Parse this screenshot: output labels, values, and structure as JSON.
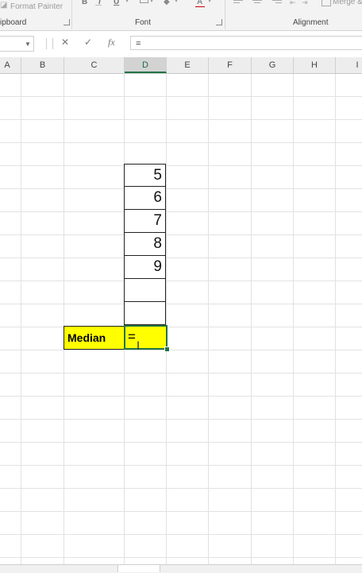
{
  "ribbon": {
    "format_painter_label": "Format Painter",
    "clipboard_group": "ipboard",
    "font_group": "Font",
    "alignment_group": "Alignment",
    "merge_label": "Merge &",
    "bold_label": "B",
    "italic_label": "I",
    "underline_label": "U"
  },
  "formula_bar": {
    "cancel_symbol": "✕",
    "enter_symbol": "✓",
    "function_symbol": "fx",
    "content": "="
  },
  "columns": [
    "A",
    "B",
    "C",
    "D",
    "E",
    "F",
    "G",
    "H",
    "I"
  ],
  "active_column": "D",
  "cells": {
    "d_values": [
      "5",
      "6",
      "7",
      "8",
      "9",
      "",
      ""
    ],
    "median_label": "Median",
    "median_input": "="
  },
  "colors": {
    "highlight": "#ffff00",
    "selection_border": "#217346"
  }
}
